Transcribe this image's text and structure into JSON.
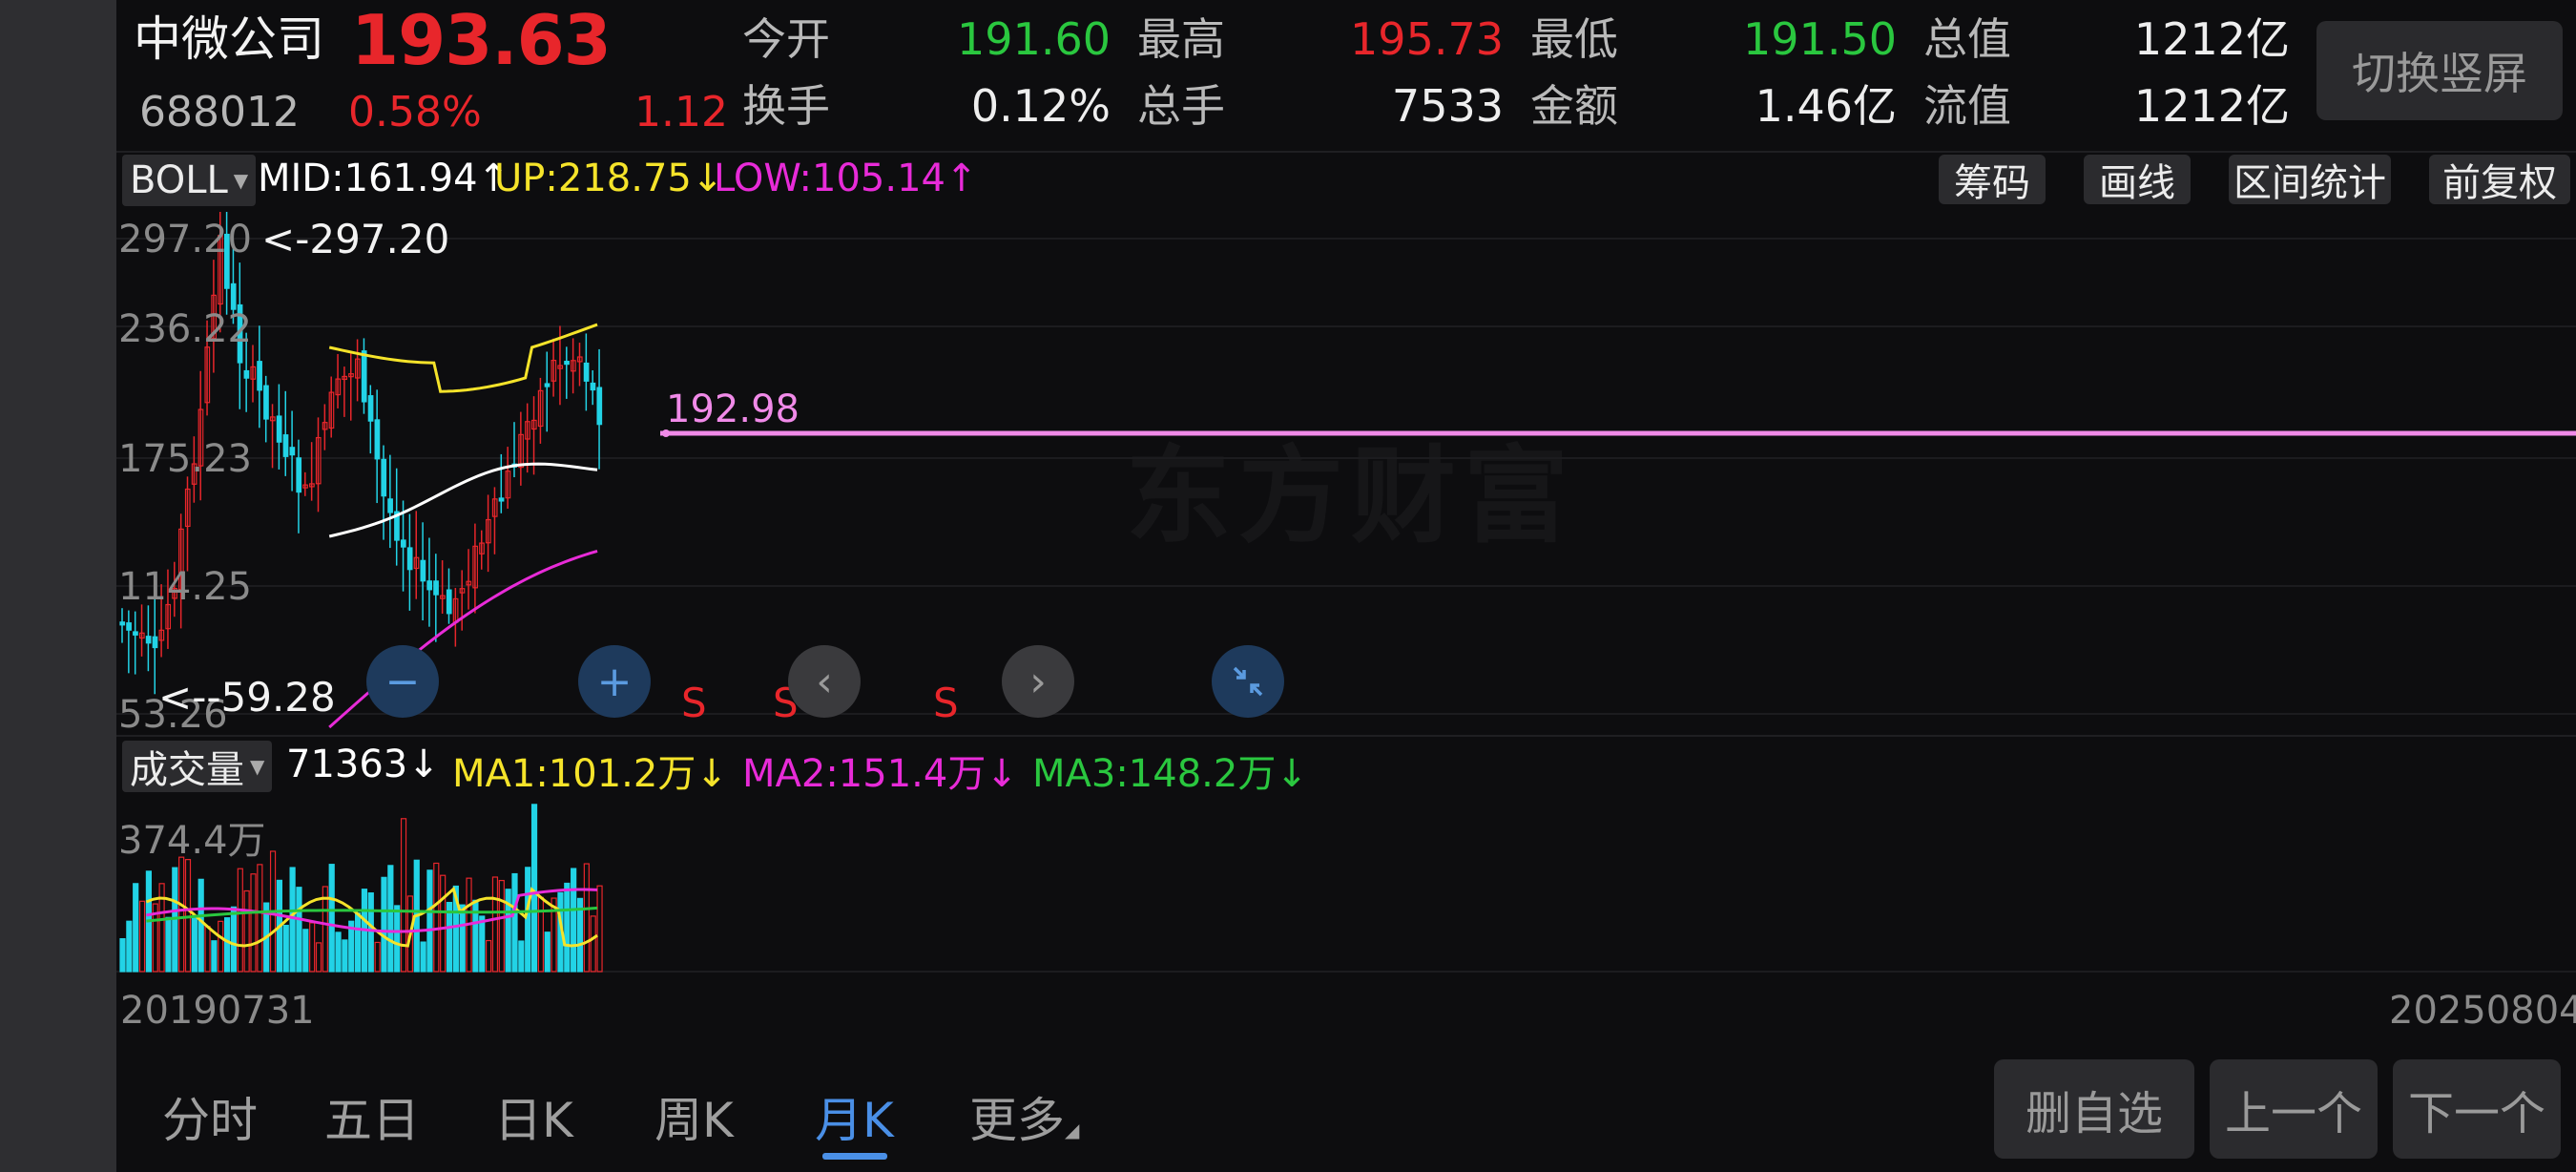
{
  "stock": {
    "name": "中微公司",
    "price": "193.63",
    "code": "688012",
    "change_pct": "0.58%",
    "change": "1.12"
  },
  "quote": {
    "open_label": "今开",
    "open_value": "191.60",
    "high_label": "最高",
    "high_value": "195.73",
    "low_label": "最低",
    "low_value": "191.50",
    "total_value_label": "总值",
    "total_value": "1212亿",
    "turnover_label": "换手",
    "turnover_value": "0.12%",
    "volume_label": "总手",
    "volume_value": "7533",
    "amount_label": "金额",
    "amount_value": "1.46亿",
    "float_value_label": "流值",
    "float_value": "1212亿"
  },
  "switch_button": "切换竖屏",
  "indicator": {
    "name": "BOLL",
    "mid": "MID:161.94↑",
    "up": "UP:218.75↓",
    "low": "LOW:105.14↑",
    "colors": {
      "mid": "#ffffff",
      "up": "#f5e32a",
      "low": "#e82bd8"
    }
  },
  "tools": {
    "chip": "筹码",
    "draw": "画线",
    "range_stats": "区间统计",
    "adjust": "前复权"
  },
  "kline": {
    "y_ticks": [
      "297.20",
      "236.22",
      "175.23",
      "114.25",
      "53.26"
    ],
    "max_marker": "<-297.20",
    "min_marker": "<--59.28",
    "current_line_label": "192.98",
    "signal_label": "S",
    "watermark": "东方财富"
  },
  "volume": {
    "name": "成交量",
    "value": "71363↓",
    "ma1": "MA1:101.2万↓",
    "ma2": "MA2:151.4万↓",
    "ma3": "MA3:148.2万↓",
    "max_tick": "374.4万",
    "colors": {
      "ma1": "#f5e32a",
      "ma2": "#e82bd8",
      "ma3": "#2ac73f"
    }
  },
  "dates": {
    "start": "20190731",
    "end": "20250804"
  },
  "tabs": [
    "分时",
    "五日",
    "日K",
    "周K",
    "月K",
    "更多"
  ],
  "active_tab": "月K",
  "bottom_buttons": {
    "remove": "删自选",
    "prev": "上一个",
    "next": "下一个"
  },
  "colors": {
    "up": "#e8262b",
    "down": "#22d3e6",
    "accent": "#4a8fe6",
    "price_line": "#f08ae8"
  }
}
